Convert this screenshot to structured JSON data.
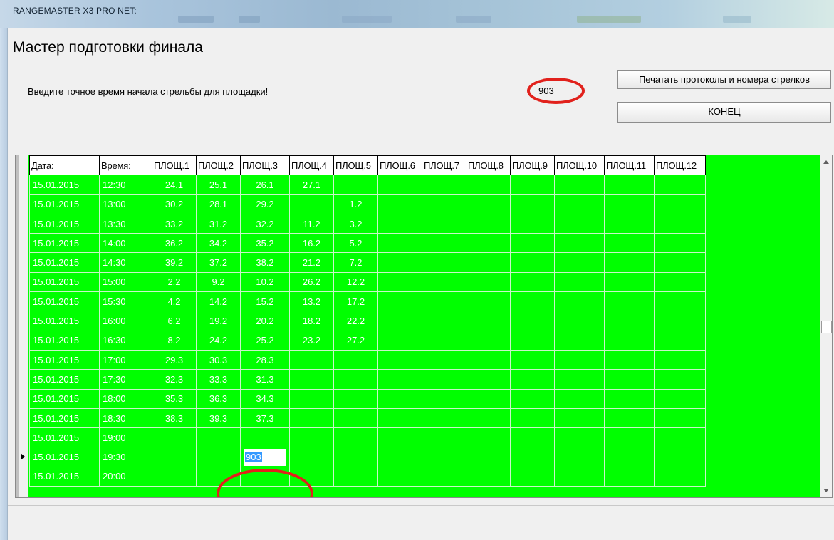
{
  "titlebar": {
    "title": "RANGEMASTER X3 PRO NET:"
  },
  "window": {
    "title": "Мастер подготовки финала",
    "instruction": "Введите точное время начала стрельбы для площадки!",
    "site_value": "903",
    "print_button": "Печатать протоколы и номера стрелков",
    "end_button": "КОНЕЦ"
  },
  "colors": {
    "grid_bg": "#00ff00",
    "highlight": "#e1211c",
    "selection": "#3399ff"
  },
  "grid": {
    "headers": [
      "Дата:",
      "Время:",
      "ПЛОЩ.1",
      "ПЛОЩ.2",
      "ПЛОЩ.3",
      "ПЛОЩ.4",
      "ПЛОЩ.5",
      "ПЛОЩ.6",
      "ПЛОЩ.7",
      "ПЛОЩ.8",
      "ПЛОЩ.9",
      "ПЛОЩ.10",
      "ПЛОЩ.11",
      "ПЛОЩ.12"
    ],
    "current_row": 14,
    "editing": {
      "row": 14,
      "col": 4,
      "value": "903"
    },
    "rows": [
      [
        "15.01.2015",
        "12:30",
        "24.1",
        "25.1",
        "26.1",
        "27.1",
        "",
        "",
        "",
        "",
        "",
        "",
        "",
        ""
      ],
      [
        "15.01.2015",
        "13:00",
        "30.2",
        "28.1",
        "29.2",
        "",
        "1.2",
        "",
        "",
        "",
        "",
        "",
        "",
        ""
      ],
      [
        "15.01.2015",
        "13:30",
        "33.2",
        "31.2",
        "32.2",
        "11.2",
        "3.2",
        "",
        "",
        "",
        "",
        "",
        "",
        ""
      ],
      [
        "15.01.2015",
        "14:00",
        "36.2",
        "34.2",
        "35.2",
        "16.2",
        "5.2",
        "",
        "",
        "",
        "",
        "",
        "",
        ""
      ],
      [
        "15.01.2015",
        "14:30",
        "39.2",
        "37.2",
        "38.2",
        "21.2",
        "7.2",
        "",
        "",
        "",
        "",
        "",
        "",
        ""
      ],
      [
        "15.01.2015",
        "15:00",
        "2.2",
        "9.2",
        "10.2",
        "26.2",
        "12.2",
        "",
        "",
        "",
        "",
        "",
        "",
        ""
      ],
      [
        "15.01.2015",
        "15:30",
        "4.2",
        "14.2",
        "15.2",
        "13.2",
        "17.2",
        "",
        "",
        "",
        "",
        "",
        "",
        ""
      ],
      [
        "15.01.2015",
        "16:00",
        "6.2",
        "19.2",
        "20.2",
        "18.2",
        "22.2",
        "",
        "",
        "",
        "",
        "",
        "",
        ""
      ],
      [
        "15.01.2015",
        "16:30",
        "8.2",
        "24.2",
        "25.2",
        "23.2",
        "27.2",
        "",
        "",
        "",
        "",
        "",
        "",
        ""
      ],
      [
        "15.01.2015",
        "17:00",
        "29.3",
        "30.3",
        "28.3",
        "",
        "",
        "",
        "",
        "",
        "",
        "",
        "",
        ""
      ],
      [
        "15.01.2015",
        "17:30",
        "32.3",
        "33.3",
        "31.3",
        "",
        "",
        "",
        "",
        "",
        "",
        "",
        "",
        ""
      ],
      [
        "15.01.2015",
        "18:00",
        "35.3",
        "36.3",
        "34.3",
        "",
        "",
        "",
        "",
        "",
        "",
        "",
        "",
        ""
      ],
      [
        "15.01.2015",
        "18:30",
        "38.3",
        "39.3",
        "37.3",
        "",
        "",
        "",
        "",
        "",
        "",
        "",
        "",
        ""
      ],
      [
        "15.01.2015",
        "19:00",
        "",
        "",
        "",
        "",
        "",
        "",
        "",
        "",
        "",
        "",
        "",
        ""
      ],
      [
        "15.01.2015",
        "19:30",
        "",
        "",
        "903",
        "",
        "",
        "",
        "",
        "",
        "",
        "",
        "",
        ""
      ],
      [
        "15.01.2015",
        "20:00",
        "",
        "",
        "",
        "",
        "",
        "",
        "",
        "",
        "",
        "",
        "",
        ""
      ]
    ]
  }
}
